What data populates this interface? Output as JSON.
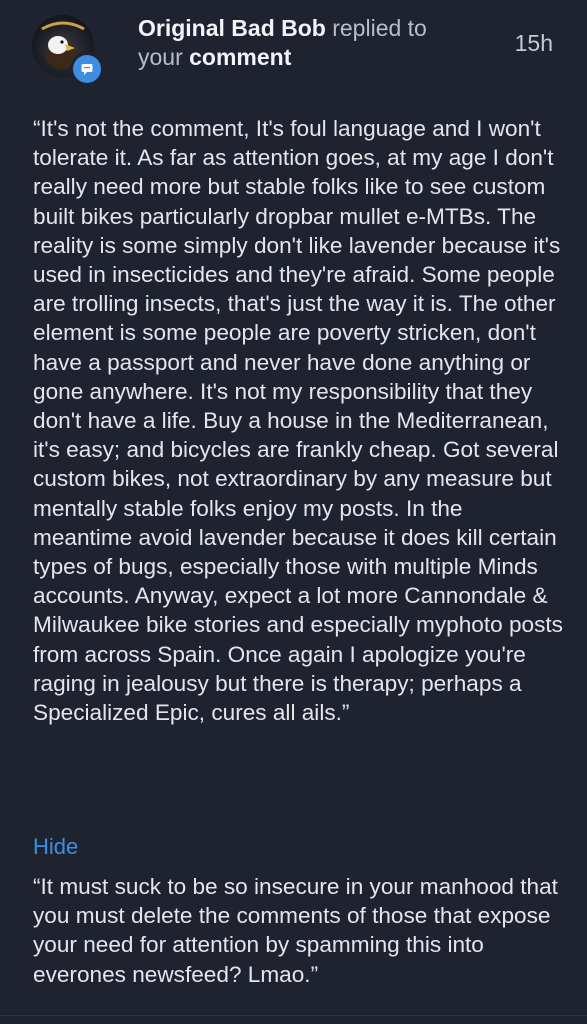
{
  "notification": {
    "username": "Original Bad Bob",
    "action_text": "replied to",
    "your_text": "your",
    "target_text": "comment",
    "timestamp": "15h",
    "avatar_icon": "eagle-avatar-icon",
    "badge_icon": "comment-icon",
    "accent_color": "#3d8de0"
  },
  "reply": {
    "body": "“It's not the comment, It's foul language and I won't tolerate it.  As far as attention goes, at my age I don't really need more but stable folks like to see custom built bikes particularly dropbar mullet e-MTBs.  The reality is some simply don't like lavender because it's used in insecticides and they're afraid.  Some people are trolling insects, that's just the way it is.  The other element is some people are poverty stricken, don't have a passport and never have done anything or gone anywhere.  It's not my responsibility that they don't have a life.  Buy a house in the Mediterranean, it's easy; and bicycles are frankly cheap.  Got several custom bikes, not extraordinary by any measure but mentally stable folks enjoy my posts. In the meantime avoid lavender because it does kill certain types of bugs, especially those with multiple Minds accounts.  Anyway, expect a lot more Cannondale & Milwaukee bike stories and especially myphoto posts from across Spain.  Once again I apologize you're raging in jealousy but there is therapy; perhaps a Specialized Epic, cures all ails.”",
    "hide_label": "Hide",
    "original_comment": "“It must suck to be so insecure in your manhood that you must delete the comments of those that expose your need for attention by spamming this into everones newsfeed? Lmao.”"
  }
}
